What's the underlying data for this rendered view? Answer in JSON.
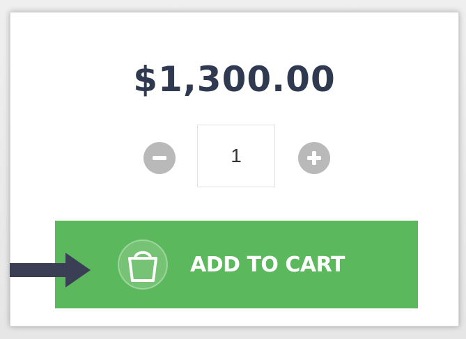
{
  "product": {
    "price": "$1,300.00"
  },
  "quantity": {
    "value": "1",
    "decrement_icon": "minus-icon",
    "increment_icon": "plus-icon"
  },
  "cart_button": {
    "label": "ADD TO CART",
    "icon": "shopping-bag-icon"
  },
  "annotation": {
    "icon": "arrow-right-icon"
  },
  "colors": {
    "price_text": "#2f3a51",
    "button_green": "#5cb85c",
    "stepper_grey": "#b9b9b9",
    "arrow": "#3b3f55"
  }
}
